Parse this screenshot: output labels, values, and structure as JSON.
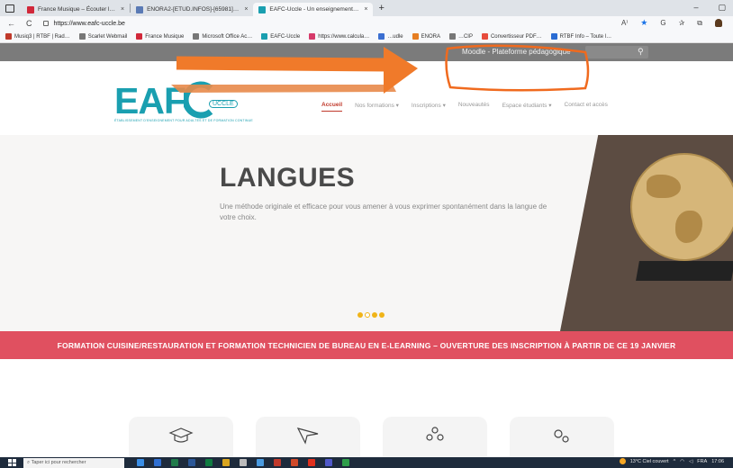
{
  "browser": {
    "tabs": [
      {
        "label": "France Musique – Écouter l…",
        "fav_color": "#d1283a",
        "active": false
      },
      {
        "label": "ENORA2-[ETUD.INFOS]-[65981]…",
        "fav_color": "#5a7ab5",
        "active": false
      },
      {
        "label": "EAFC-Uccle - Un enseignement…",
        "fav_color": "#1a9fb0",
        "active": true
      }
    ],
    "tab_close": "×",
    "new_tab": "+",
    "minimize": "–",
    "restore": "▢",
    "back": "←",
    "reload": "C",
    "url": "https://www.eafc-uccle.be",
    "bookmarks": [
      {
        "label": "Musiq3 | RTBF | Rad…",
        "color": "#c0392b"
      },
      {
        "label": "Scarlet Webmail",
        "color": "#777777"
      },
      {
        "label": "France Musique",
        "color": "#d1283a"
      },
      {
        "label": "Microsoft Office Ac…",
        "color": "#777777"
      },
      {
        "label": "EAFC-Uccle",
        "color": "#1a9fb0"
      },
      {
        "label": "https://www.calcula…",
        "color": "#d63a6a"
      },
      {
        "label": "…udle",
        "color": "#3b6fd1"
      },
      {
        "label": "ENORA",
        "color": "#e67e22"
      },
      {
        "label": "…CIP",
        "color": "#777777"
      },
      {
        "label": "Convertisseur PDF…",
        "color": "#e74c3c"
      },
      {
        "label": "RTBF Info – Toute l…",
        "color": "#2a6cd3"
      }
    ]
  },
  "site": {
    "moodle_link": "Moodle - Plateforme pédagogique",
    "search_icon": "⚲",
    "logo": {
      "text": "EAF",
      "badge": "UCCLE",
      "tagline": "ÉTABLISSEMENT D'ENSEIGNEMENT POUR ADULTES ET DE FORMATION CONTINUE"
    },
    "nav": [
      {
        "label": "Accueil",
        "active": true
      },
      {
        "label": "Nos formations  ▾",
        "active": false
      },
      {
        "label": "Inscriptions  ▾",
        "active": false
      },
      {
        "label": "Nouveautés",
        "active": false
      },
      {
        "label": "Espace étudiants  ▾",
        "active": false
      },
      {
        "label": "Contact et accès",
        "active": false
      }
    ],
    "hero": {
      "title": "LANGUES",
      "text": "Une méthode originale et efficace pour vous amener à vous exprimer spontanément dans la langue de votre choix."
    },
    "banner": "FORMATION CUISINE/RESTAURATION ET FORMATION TECHNICIEN DE BUREAU EN E-LEARNING – OUVERTURE DES INSCRIPTION À PARTIR DE CE 19 JANVIER"
  },
  "annotation": {
    "arrow_color": "#f07a2a",
    "outline_color": "#f06a1e"
  },
  "taskbar": {
    "search_placeholder": "Taper ici pour rechercher",
    "weather": "13°C  Ciel couvert",
    "lang": "FRA",
    "time": "17:06"
  }
}
